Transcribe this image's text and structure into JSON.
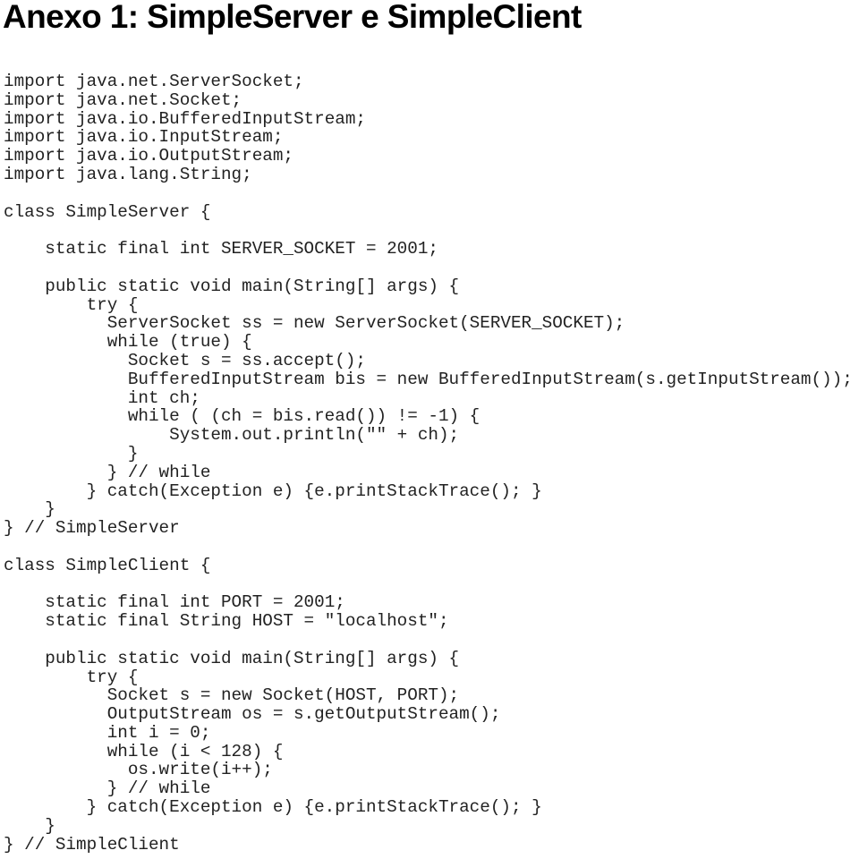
{
  "document": {
    "title": "Anexo 1: SimpleServer e SimpleClient",
    "code_lines": [
      {
        "indent": 0,
        "text": "import java.net.ServerSocket;"
      },
      {
        "indent": 0,
        "text": "import java.net.Socket;"
      },
      {
        "indent": 0,
        "text": "import java.io.BufferedInputStream;"
      },
      {
        "indent": 0,
        "text": "import java.io.InputStream;"
      },
      {
        "indent": 0,
        "text": "import java.io.OutputStream;"
      },
      {
        "indent": 0,
        "text": "import java.lang.String;"
      },
      {
        "indent": 0,
        "text": ""
      },
      {
        "indent": 0,
        "text": "class SimpleServer {"
      },
      {
        "indent": 0,
        "text": ""
      },
      {
        "indent": 4,
        "text": "static final int SERVER_SOCKET = 2001;"
      },
      {
        "indent": 0,
        "text": ""
      },
      {
        "indent": 4,
        "text": "public static void main(String[] args) {"
      },
      {
        "indent": 8,
        "text": "try {"
      },
      {
        "indent": 10,
        "text": "ServerSocket ss = new ServerSocket(SERVER_SOCKET);"
      },
      {
        "indent": 10,
        "text": "while (true) {"
      },
      {
        "indent": 12,
        "text": "Socket s = ss.accept();"
      },
      {
        "indent": 12,
        "text": "BufferedInputStream bis = new BufferedInputStream(s.getInputStream());"
      },
      {
        "indent": 12,
        "text": "int ch;"
      },
      {
        "indent": 12,
        "text": "while ( (ch = bis.read()) != -1) {"
      },
      {
        "indent": 16,
        "text": "System.out.println(\"\" + ch);"
      },
      {
        "indent": 12,
        "text": "}"
      },
      {
        "indent": 10,
        "text": "} // while"
      },
      {
        "indent": 8,
        "text": "} catch(Exception e) {e.printStackTrace(); }"
      },
      {
        "indent": 4,
        "text": "}"
      },
      {
        "indent": 0,
        "text": "} // SimpleServer"
      },
      {
        "indent": 0,
        "text": ""
      },
      {
        "indent": 0,
        "text": "class SimpleClient {"
      },
      {
        "indent": 0,
        "text": ""
      },
      {
        "indent": 4,
        "text": "static final int PORT = 2001;"
      },
      {
        "indent": 4,
        "text": "static final String HOST = \"localhost\";"
      },
      {
        "indent": 0,
        "text": ""
      },
      {
        "indent": 4,
        "text": "public static void main(String[] args) {"
      },
      {
        "indent": 8,
        "text": "try {"
      },
      {
        "indent": 10,
        "text": "Socket s = new Socket(HOST, PORT);"
      },
      {
        "indent": 10,
        "text": "OutputStream os = s.getOutputStream();"
      },
      {
        "indent": 10,
        "text": "int i = 0;"
      },
      {
        "indent": 10,
        "text": "while (i < 128) {"
      },
      {
        "indent": 12,
        "text": "os.write(i++);"
      },
      {
        "indent": 10,
        "text": "} // while"
      },
      {
        "indent": 8,
        "text": "} catch(Exception e) {e.printStackTrace(); }"
      },
      {
        "indent": 4,
        "text": "}"
      },
      {
        "indent": 0,
        "text": "} // SimpleClient"
      }
    ]
  }
}
